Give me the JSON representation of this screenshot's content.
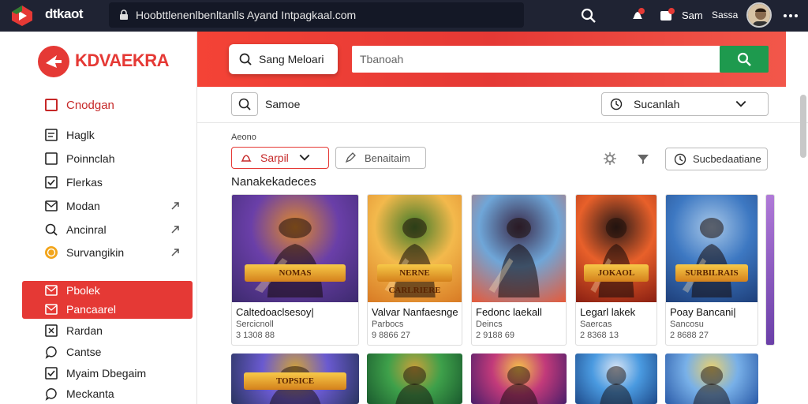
{
  "browser": {
    "app_name": "dtkaot",
    "url": "Hoobttlenenlbenltanlls Ayand Intpagkaal.com",
    "user_short": "Sam",
    "user_status": "Sassa",
    "icons": [
      "search-icon",
      "notification-icon",
      "messages-icon",
      "more-icon"
    ]
  },
  "sidebar": {
    "logo_text": "KDVAEKRA",
    "section_title": "Cnodgan",
    "items": [
      {
        "label": "Haglk",
        "icon": "document-icon"
      },
      {
        "label": "Poinnclah",
        "icon": "square-icon"
      },
      {
        "label": "Flerkas",
        "icon": "check-square-icon"
      },
      {
        "label": "Modan",
        "icon": "mail-icon",
        "chevron": "expand-arrow"
      },
      {
        "label": "Ancinral",
        "icon": "search-icon",
        "chevron": "expand-arrow"
      },
      {
        "label": "Survangikin",
        "icon": "coin-icon",
        "chevron": "expand-arrow"
      }
    ],
    "active_items": [
      {
        "label": "Pbolek",
        "icon": "mail-icon"
      },
      {
        "label": "Pancaarel",
        "icon": "mail-icon"
      }
    ],
    "bottom_items": [
      {
        "label": "Rardan",
        "icon": "x-square-icon"
      },
      {
        "label": "Cantse",
        "icon": "chat-icon"
      },
      {
        "label": "Myaim Dbegaim",
        "icon": "check-square-icon"
      },
      {
        "label": "Meckanta",
        "icon": "chat-icon"
      }
    ]
  },
  "hero": {
    "pill_label": "Sang Meloari",
    "search_placeholder": "Tbanoah"
  },
  "toolbar": {
    "search_label": "Samoe",
    "dropdown_value": "Sucanlah"
  },
  "filters": {
    "small_label": "Aeono",
    "select_value": "Sarpil",
    "button_label": "Benaitaim",
    "right_button_label": "Sucbedaatiane"
  },
  "section": {
    "title": "Nanakekadeces"
  },
  "games": [
    {
      "title": "Caltedoaclsesoy|",
      "subtitle": "Sercicnoll",
      "price": "3 1308 88",
      "banner": "NOMAS",
      "colors": [
        "#3d2a6e",
        "#6a3fa8",
        "#e08a2a"
      ]
    },
    {
      "title": "Valvar Nanfaesnge",
      "subtitle": "Parbocs",
      "price": "9 8866 27",
      "banner": "NERNE CARLRIERE",
      "colors": [
        "#d87a24",
        "#f3b94c",
        "#3f7a2a"
      ]
    },
    {
      "title": "Fedonc laekall",
      "subtitle": "Deincs",
      "price": "2 9188 69",
      "banner": "",
      "colors": [
        "#e65a3a",
        "#6fa6d8",
        "#3a2a4a"
      ]
    },
    {
      "title": "Legarl lakek",
      "subtitle": "Saercas",
      "price": "2 8368 13",
      "banner": "JOKAOL",
      "colors": [
        "#8a1f12",
        "#e8602a",
        "#2a1a18"
      ]
    },
    {
      "title": "Poay Bancani|",
      "subtitle": "Sancosu",
      "price": "2 8688 27",
      "banner": "SURBILRAIS",
      "colors": [
        "#1e3f7a",
        "#3d78c2",
        "#a7c7e8"
      ]
    }
  ],
  "games_row2": [
    {
      "banner": "TOPSICE",
      "colors": [
        "#2a3560",
        "#6a5ad0",
        "#d0a23a"
      ]
    },
    {
      "banner": "",
      "colors": [
        "#1a5a2e",
        "#3ea04a",
        "#caa03a"
      ]
    },
    {
      "banner": "",
      "colors": [
        "#4a1e6a",
        "#c23a7a",
        "#f5c14a"
      ]
    },
    {
      "banner": "",
      "colors": [
        "#1e4a8a",
        "#4a9ae0",
        "#d8e4f4"
      ]
    },
    {
      "banner": "",
      "colors": [
        "#2a5aa8",
        "#78b0e8",
        "#e8d070"
      ]
    }
  ]
}
